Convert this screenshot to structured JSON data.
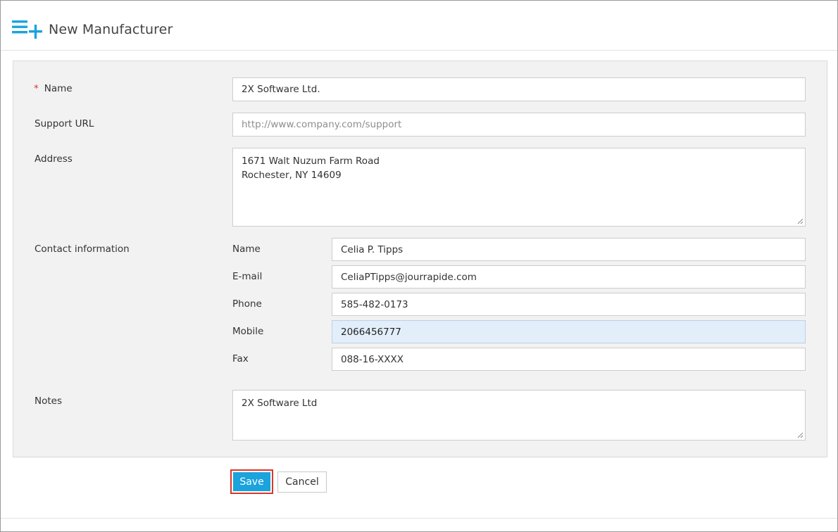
{
  "header": {
    "title": "New Manufacturer",
    "icon": "list-add-icon"
  },
  "form": {
    "name": {
      "label": "Name",
      "required_mark": "*",
      "value": "2X Software Ltd."
    },
    "support_url": {
      "label": "Support URL",
      "value": "",
      "placeholder": "http://www.company.com/support"
    },
    "address": {
      "label": "Address",
      "lines": [
        "1671 Walt Nuzum Farm Road",
        "Rochester, NY 14609"
      ]
    },
    "contact": {
      "label": "Contact information",
      "name": {
        "label": "Name",
        "value": "Celia P. Tipps"
      },
      "email": {
        "label": "E-mail",
        "value": "CeliaPTipps@jourrapide.com"
      },
      "phone": {
        "label": "Phone",
        "value": "585-482-0173"
      },
      "mobile": {
        "label": "Mobile",
        "value": "2066456777"
      },
      "fax": {
        "label": "Fax",
        "value": "088-16-XXXX"
      }
    },
    "notes": {
      "label": "Notes",
      "value": "2X Software Ltd"
    }
  },
  "actions": {
    "save_label": "Save",
    "cancel_label": "Cancel"
  },
  "colors": {
    "accent": "#1aa3dd",
    "required": "#d9362b",
    "focus_bg": "#e3eefb",
    "panel_bg": "#f2f2f2"
  }
}
